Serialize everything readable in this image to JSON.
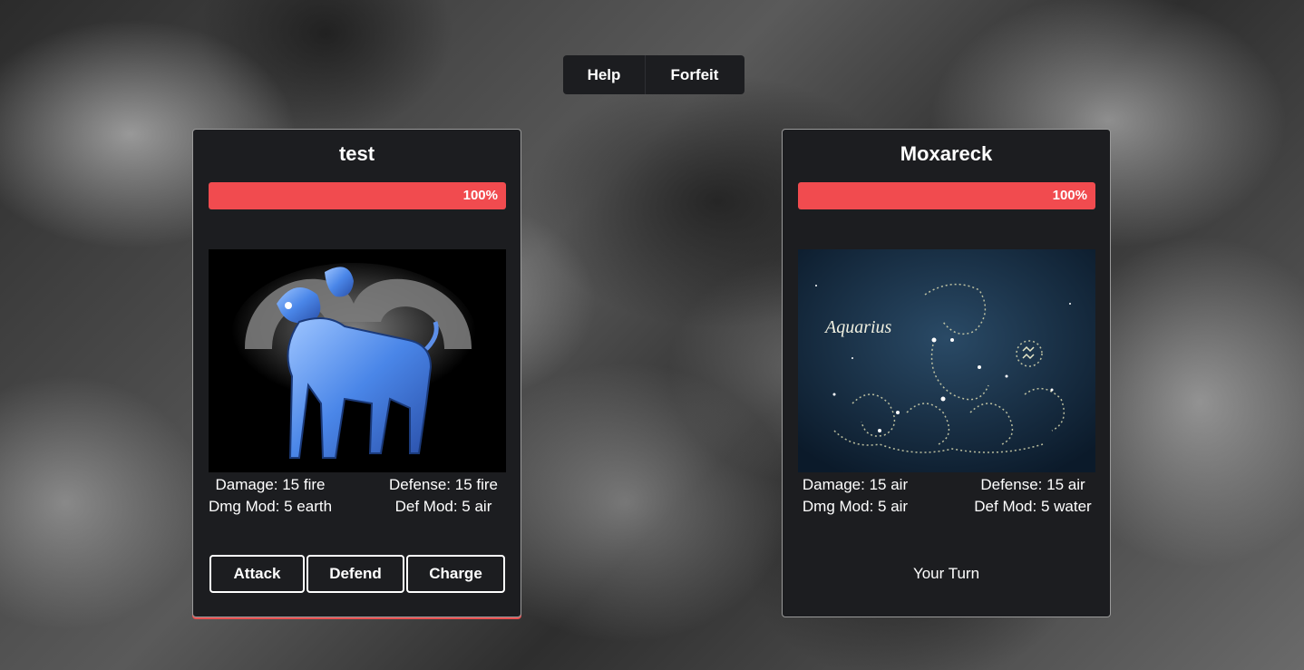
{
  "topbar": {
    "help_label": "Help",
    "forfeit_label": "Forfeit"
  },
  "player": {
    "name": "test",
    "health_percent": 100,
    "health_label": "100%",
    "sign_icon": "aries-ram-icon",
    "stats": {
      "damage": "Damage: 15 fire",
      "defense": "Defense: 15 fire",
      "dmg_mod": "Dmg Mod: 5 earth",
      "def_mod": "Def Mod: 5 air"
    },
    "actions": {
      "attack": "Attack",
      "defend": "Defend",
      "charge": "Charge"
    }
  },
  "opponent": {
    "name": "Moxareck",
    "health_percent": 100,
    "health_label": "100%",
    "sign_icon": "aquarius-constellation-icon",
    "portrait_text": "Aquarius",
    "stats": {
      "damage": "Damage: 15 air",
      "defense": "Defense: 15 air",
      "dmg_mod": "Dmg Mod: 5 air",
      "def_mod": "Def Mod: 5 water"
    },
    "status": "Your Turn"
  },
  "colors": {
    "health_bar": "#f14b4f",
    "card_bg": "#1c1d20"
  }
}
